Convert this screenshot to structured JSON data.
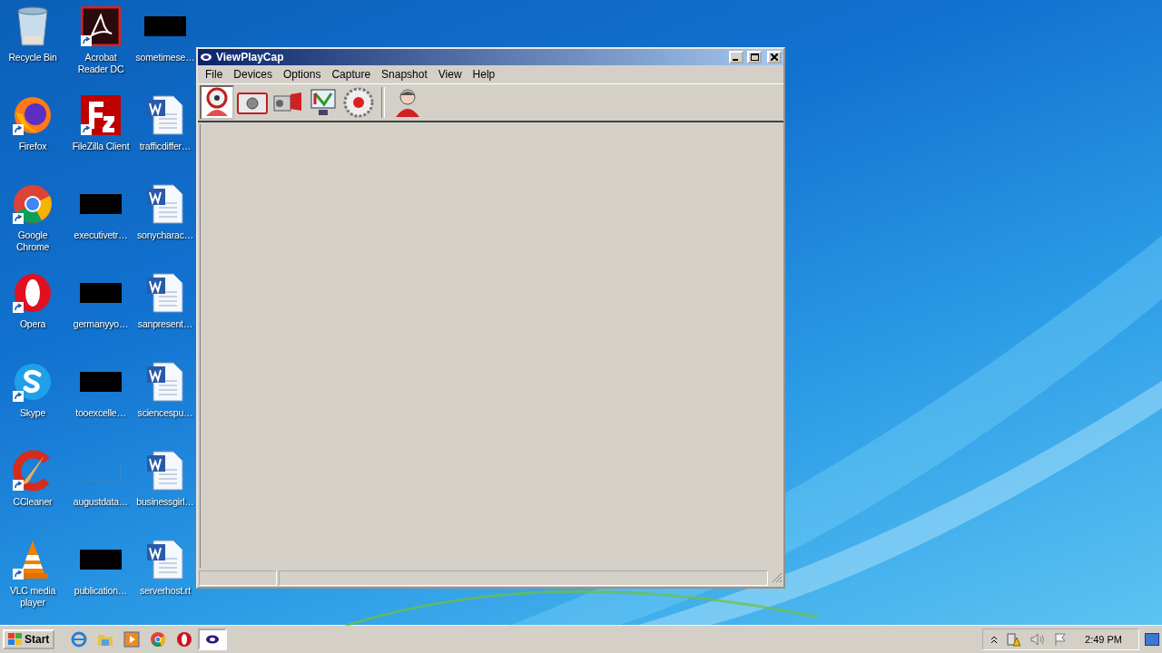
{
  "desktop_icons": [
    {
      "label": "Recycle Bin",
      "kind": "recycle",
      "shortcut": false
    },
    {
      "label": "Acrobat\nReader DC",
      "kind": "acrobat",
      "shortcut": true
    },
    {
      "label": "sometimese…",
      "kind": "redacted",
      "shortcut": false
    },
    {
      "label": "Firefox",
      "kind": "firefox",
      "shortcut": true
    },
    {
      "label": "FileZilla Client",
      "kind": "filezilla",
      "shortcut": true
    },
    {
      "label": "trafficdiffer…",
      "kind": "word",
      "shortcut": false
    },
    {
      "label": "Google\nChrome",
      "kind": "chrome",
      "shortcut": true
    },
    {
      "label": "executivetr…",
      "kind": "redacted",
      "shortcut": false
    },
    {
      "label": "sonycharac…",
      "kind": "word",
      "shortcut": false
    },
    {
      "label": "Opera",
      "kind": "opera",
      "shortcut": true
    },
    {
      "label": "germanyyo…",
      "kind": "redacted",
      "shortcut": false
    },
    {
      "label": "sanpresent…",
      "kind": "word",
      "shortcut": false
    },
    {
      "label": "Skype",
      "kind": "skype",
      "shortcut": true
    },
    {
      "label": "tooexcelle…",
      "kind": "redacted",
      "shortcut": false
    },
    {
      "label": "sciencespu…",
      "kind": "word",
      "shortcut": false
    },
    {
      "label": "CCleaner",
      "kind": "ccleaner",
      "shortcut": true
    },
    {
      "label": "augustdata…",
      "kind": "blank",
      "shortcut": false
    },
    {
      "label": "businessgirl…",
      "kind": "word",
      "shortcut": false
    },
    {
      "label": "VLC media\nplayer",
      "kind": "vlc",
      "shortcut": true
    },
    {
      "label": "publication…",
      "kind": "redacted",
      "shortcut": false
    },
    {
      "label": "serverhost.rt",
      "kind": "word",
      "shortcut": false
    }
  ],
  "window": {
    "title": "ViewPlayCap",
    "menu": [
      "File",
      "Devices",
      "Options",
      "Capture",
      "Snapshot",
      "View",
      "Help"
    ],
    "toolbar": [
      {
        "kind": "webcam",
        "selected": true
      },
      {
        "kind": "camera",
        "selected": false
      },
      {
        "kind": "camcorder",
        "selected": false
      },
      {
        "kind": "monitor",
        "selected": false
      },
      {
        "kind": "record",
        "selected": false
      },
      {
        "kind": "separator"
      },
      {
        "kind": "user",
        "selected": false
      }
    ]
  },
  "taskbar": {
    "start": "Start",
    "quick_launch": [
      {
        "kind": "ie"
      },
      {
        "kind": "folder"
      },
      {
        "kind": "media"
      },
      {
        "kind": "chrome"
      },
      {
        "kind": "opera"
      }
    ],
    "tasks": [
      {
        "kind": "viewplaycap",
        "selected": true
      }
    ],
    "clock": "2:49 PM"
  }
}
